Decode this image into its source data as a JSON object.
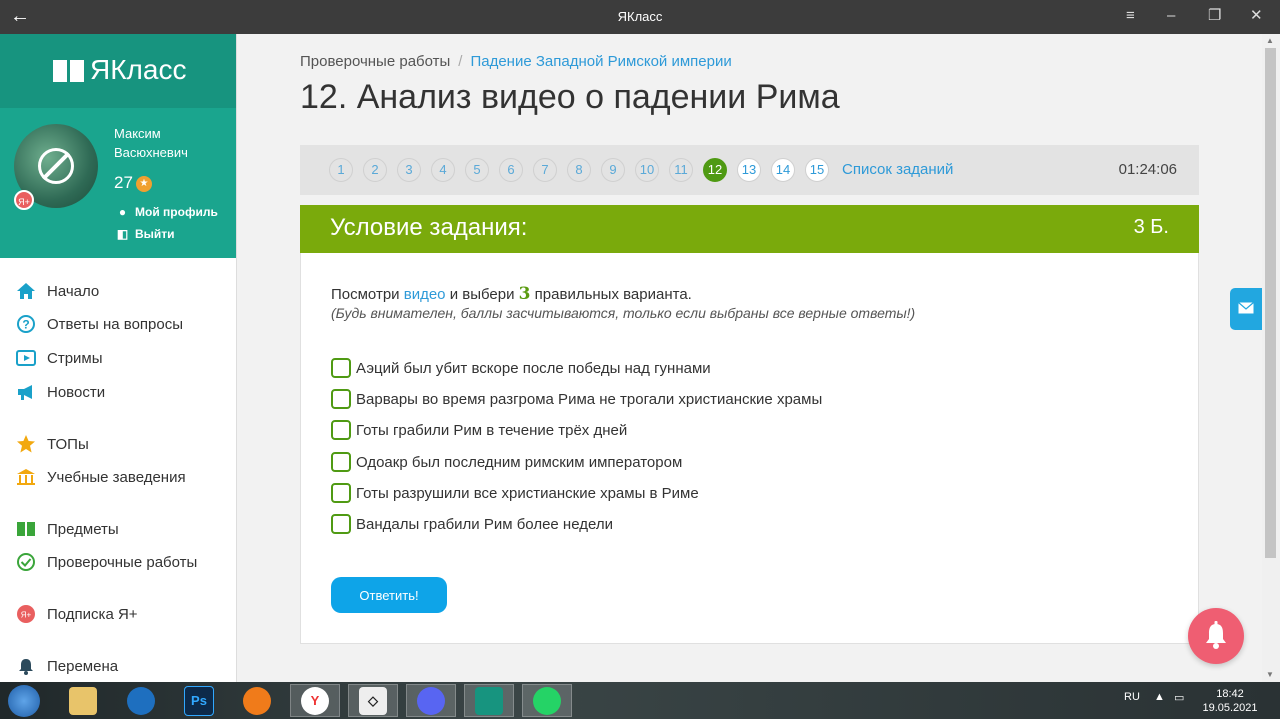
{
  "window": {
    "title": "ЯКласс"
  },
  "brand": {
    "name": "ЯКласс"
  },
  "profile": {
    "first_name": "Максим",
    "last_name": "Васюхневич",
    "points": "27",
    "badge": "Я+",
    "my_profile": "Мой профиль",
    "logout": "Выйти"
  },
  "nav": {
    "items": [
      {
        "label": "Начало",
        "icon": "home-icon"
      },
      {
        "label": "Ответы на вопросы",
        "icon": "question-icon"
      },
      {
        "label": "Стримы",
        "icon": "play-icon"
      },
      {
        "label": "Новости",
        "icon": "megaphone-icon"
      },
      {
        "label": "ТОПы",
        "icon": "star-icon"
      },
      {
        "label": "Учебные заведения",
        "icon": "school-icon"
      },
      {
        "label": "Предметы",
        "icon": "books-icon"
      },
      {
        "label": "Проверочные работы",
        "icon": "check-icon"
      },
      {
        "label": "Подписка Я+",
        "icon": "ya-plus-icon"
      },
      {
        "label": "Перемена",
        "icon": "bell-icon"
      }
    ]
  },
  "breadcrumb": {
    "root": "Проверочные работы",
    "separator": "/",
    "current": "Падение Западной Римской империи"
  },
  "page": {
    "title": "12. Анализ видео о падении Рима"
  },
  "tasks": {
    "numbers": [
      "1",
      "2",
      "3",
      "4",
      "5",
      "6",
      "7",
      "8",
      "9",
      "10",
      "11",
      "12",
      "13",
      "14",
      "15"
    ],
    "active": "12",
    "list_link": "Список заданий",
    "timer": "01:24:06"
  },
  "task": {
    "header": "Условие задания:",
    "points": "3 Б.",
    "question": {
      "pre": "Посмотри",
      "link": "видео",
      "mid": "и выбери",
      "count": "3",
      "post": "правильных варианта."
    },
    "hint": "(Будь внимателен, баллы засчитываются, только если выбраны все верные ответы!)",
    "options": [
      "Аэций был убит вскоре после победы над гуннами",
      "Варвары во время разгрома Рима не трогали христианские храмы",
      "Готы грабили Рим в течение трёх дней",
      "Одоакр был последним римским императором",
      "Готы разрушили все христианские храмы в Риме",
      "Вандалы грабили Рим более недели"
    ],
    "submit": "Ответить!"
  },
  "os_taskbar": {
    "language": "RU",
    "time": "18:42",
    "date": "19.05.2021",
    "apps": [
      "explorer-icon",
      "network-icon",
      "photoshop-icon",
      "headphones-icon",
      "yandex-icon",
      "unity-icon",
      "discord-icon",
      "yaklass-icon",
      "whatsapp-icon"
    ]
  },
  "colors": {
    "brand_green": "#17947f",
    "header_green": "#7aaa0c",
    "active_task": "#4f9a13",
    "link_blue": "#2e9ad8",
    "button_blue": "#0ea4e8",
    "bell_pink": "#ef5e72"
  }
}
